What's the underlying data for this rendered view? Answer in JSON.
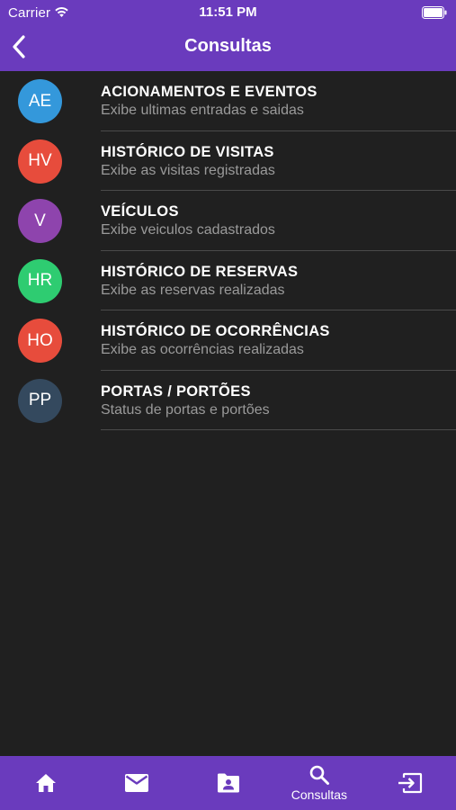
{
  "status_bar": {
    "carrier": "Carrier",
    "time": "11:51 PM"
  },
  "nav": {
    "title": "Consultas",
    "back_icon": "chevron-left-icon"
  },
  "list": [
    {
      "initials": "AE",
      "color": "#3498db",
      "title": "ACIONAMENTOS E EVENTOS",
      "subtitle": "Exibe ultimas entradas e saidas"
    },
    {
      "initials": "HV",
      "color": "#e74c3c",
      "title": "HISTÓRICO DE VISITAS",
      "subtitle": "Exibe as visitas registradas"
    },
    {
      "initials": "V",
      "color": "#8e44ad",
      "title": "VEÍCULOS",
      "subtitle": "Exibe veiculos cadastrados"
    },
    {
      "initials": "HR",
      "color": "#2ecc71",
      "title": "HISTÓRICO DE RESERVAS",
      "subtitle": "Exibe as reservas realizadas"
    },
    {
      "initials": "HO",
      "color": "#e74c3c",
      "title": "HISTÓRICO DE OCORRÊNCIAS",
      "subtitle": "Exibe as ocorrências realizadas"
    },
    {
      "initials": "PP",
      "color": "#34495e",
      "title": "PORTAS / PORTÕES",
      "subtitle": "Status de portas e portões"
    }
  ],
  "tabs": [
    {
      "icon": "home-icon",
      "label": ""
    },
    {
      "icon": "mail-icon",
      "label": ""
    },
    {
      "icon": "contact-folder-icon",
      "label": ""
    },
    {
      "icon": "search-icon",
      "label": "Consultas"
    },
    {
      "icon": "logout-icon",
      "label": ""
    }
  ],
  "colors": {
    "brand": "#6a3bbd",
    "background": "#202020",
    "subtitle": "#9a9a9a"
  }
}
